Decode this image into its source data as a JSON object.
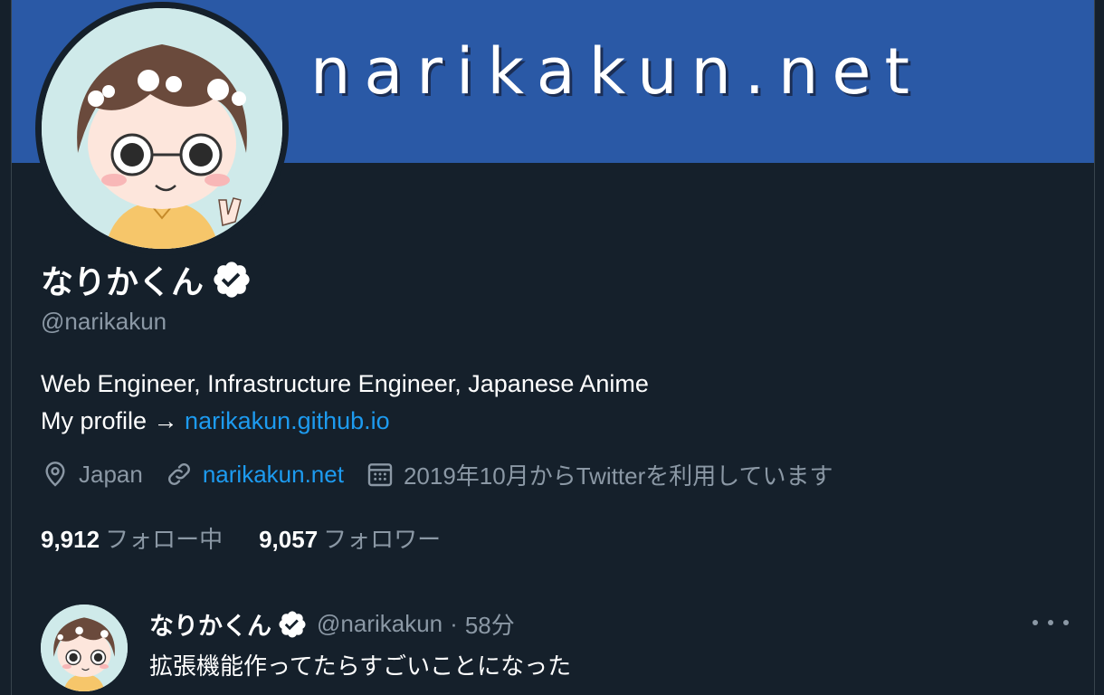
{
  "banner": {
    "top_text": "",
    "site_text": "narikakun.net"
  },
  "profile": {
    "display_name": "なりかくん",
    "handle": "@narikakun",
    "bio_line1": "Web Engineer, Infrastructure Engineer, Japanese Anime",
    "bio_line2_prefix": "My profile → ",
    "bio_link": "narikakun.github.io",
    "location": "Japan",
    "website": "narikakun.net",
    "joined": "2019年10月からTwitterを利用しています",
    "following_count": "9,912",
    "following_label": "フォロー中",
    "followers_count": "9,057",
    "followers_label": "フォロワー"
  },
  "tweet": {
    "name": "なりかくん",
    "handle": "@narikakun",
    "separator": "·",
    "time": "58分",
    "text": "拡張機能作ってたらすごいことになった"
  },
  "icons": {
    "verified": "verified-badge-icon",
    "location": "location-pin-icon",
    "link": "link-icon",
    "calendar": "calendar-icon",
    "more": "more-icon"
  },
  "colors": {
    "background": "#15202b",
    "banner": "#2a59a6",
    "link": "#1d9bf0",
    "muted": "#8b98a5"
  }
}
